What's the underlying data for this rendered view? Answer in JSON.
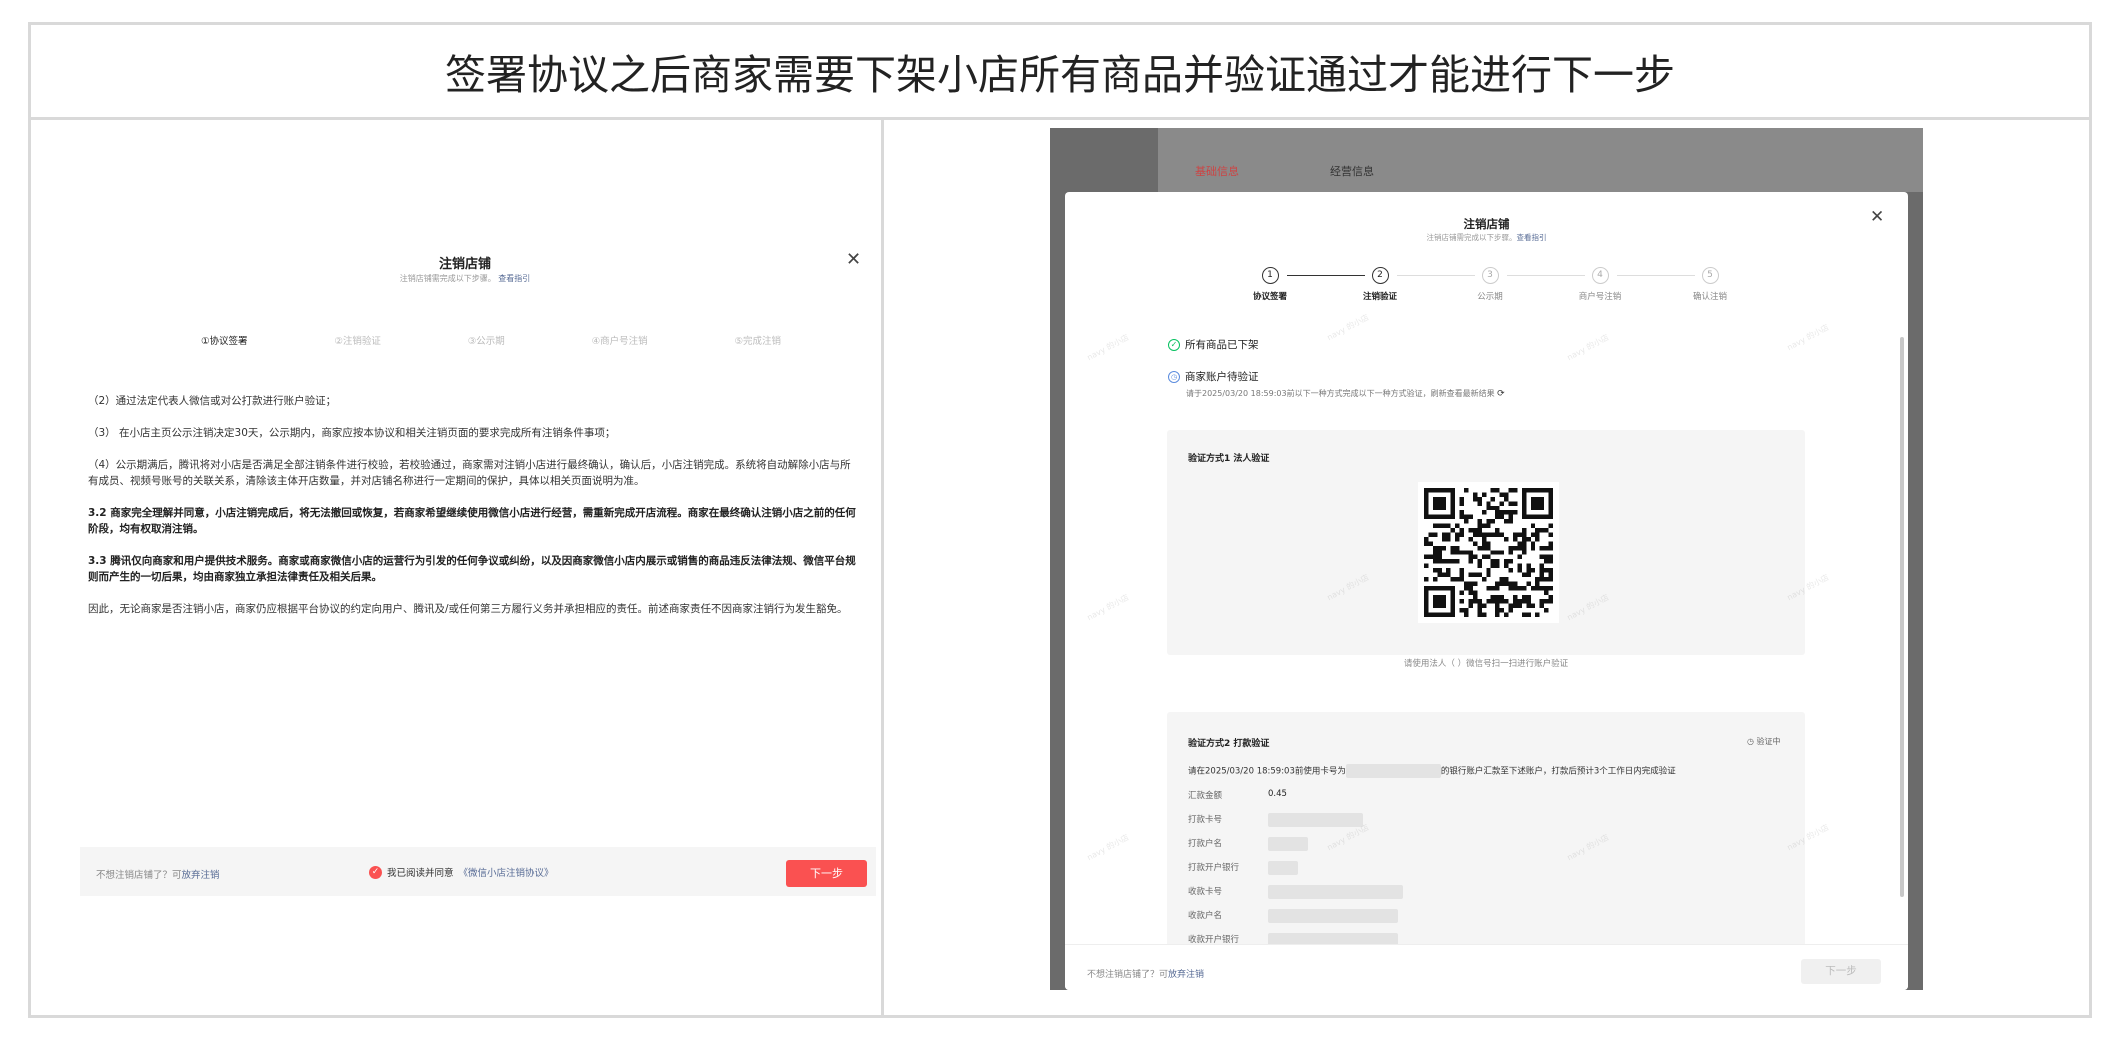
{
  "header": {
    "title": "签署协议之后商家需要下架小店所有商品并验证通过才能进行下一步"
  },
  "left": {
    "title": "注销店铺",
    "subtitle": "注销店铺需完成以下步骤。",
    "guide_link": "查看指引",
    "steps": [
      "①协议签署",
      "②注销验证",
      "③公示期",
      "④商户号注销",
      "⑤完成注销"
    ],
    "paragraphs": [
      "（2）通过法定代表人微信或对公打款进行账户验证；",
      "（3） 在小店主页公示注销决定30天，公示期内，商家应按本协议和相关注销页面的要求完成所有注销条件事项；",
      "（4）公示期满后，腾讯将对小店是否满足全部注销条件进行校验，若校验通过，商家需对注销小店进行最终确认，确认后，小店注销完成。系统将自动解除小店与所有成员、视频号账号的关联关系，清除该主体开店数量，并对店铺名称进行一定期间的保护，具体以相关页面说明为准。"
    ],
    "bold_paragraphs": [
      "3.2 商家完全理解并同意，小店注销完成后，将无法撤回或恢复，若商家希望继续使用微信小店进行经营，需重新完成开店流程。商家在最终确认注销小店之前的任何阶段，均有权取消注销。",
      "3.3 腾讯仅向商家和用户提供技术服务。商家或商家微信小店的运营行为引发的任何争议或纠纷，以及因商家微信小店内展示或销售的商品违反法律法规、微信平台规则而产生的一切后果，均由商家独立承担法律责任及相关后果。"
    ],
    "final_paragraph": "因此，无论商家是否注销小店，商家仍应根据平台协议的约定向用户、腾讯及/或任何第三方履行义务并承担相应的责任。前述商家责任不因商家注销行为发生豁免。",
    "footer_question": "不想注销店铺了？可",
    "abandon_link": "放弃注销",
    "agree_text": "我已阅读并同意",
    "agreement_link": "《微信小店注销协议》",
    "next_label": "下一步"
  },
  "right": {
    "bg_tab_1": "基础信息",
    "bg_tab_2": "经营信息",
    "title": "注销店铺",
    "subtitle": "注销店铺需完成以下步骤。",
    "guide_link": "查看指引",
    "steps": [
      {
        "num": "1",
        "label": "协议签署"
      },
      {
        "num": "2",
        "label": "注销验证"
      },
      {
        "num": "3",
        "label": "公示期"
      },
      {
        "num": "4",
        "label": "商户号注销"
      },
      {
        "num": "5",
        "label": "确认注销"
      }
    ],
    "status_1": "所有商品已下架",
    "status_2": "商家账户待验证",
    "status_2_sub": "请于2025/03/20 18:59:03前以下一种方式完成以下一种方式验证，刷新查看最新结果",
    "method_1_title": "验证方式1 法人验证",
    "method_1_caption": "请使用法人（     ）微信号扫一扫进行账户验证",
    "method_2_title": "验证方式2 打款验证",
    "method_2_badge": "验证中",
    "method_2_desc_a": "请在2025/03/20 18:59:03前使用卡号为",
    "method_2_desc_b": "的银行账户汇款至下述账户，打款后预计3个工作日内完成验证",
    "fields": [
      {
        "label": "汇款金额",
        "value": "0.45"
      },
      {
        "label": "打款卡号",
        "value": ""
      },
      {
        "label": "打款户名",
        "value": ""
      },
      {
        "label": "打款开户银行",
        "value": ""
      },
      {
        "label": "收款卡号",
        "value": ""
      },
      {
        "label": "收款户名",
        "value": ""
      },
      {
        "label": "收款开户银行",
        "value": ""
      }
    ],
    "footer_question": "不想注销店铺了？可",
    "abandon_link": "放弃注销",
    "next_label": "下一步",
    "watermark": "navy 的小店"
  },
  "colors": {
    "accent": "#fa5151",
    "link": "#576b95",
    "success": "#07c160"
  }
}
